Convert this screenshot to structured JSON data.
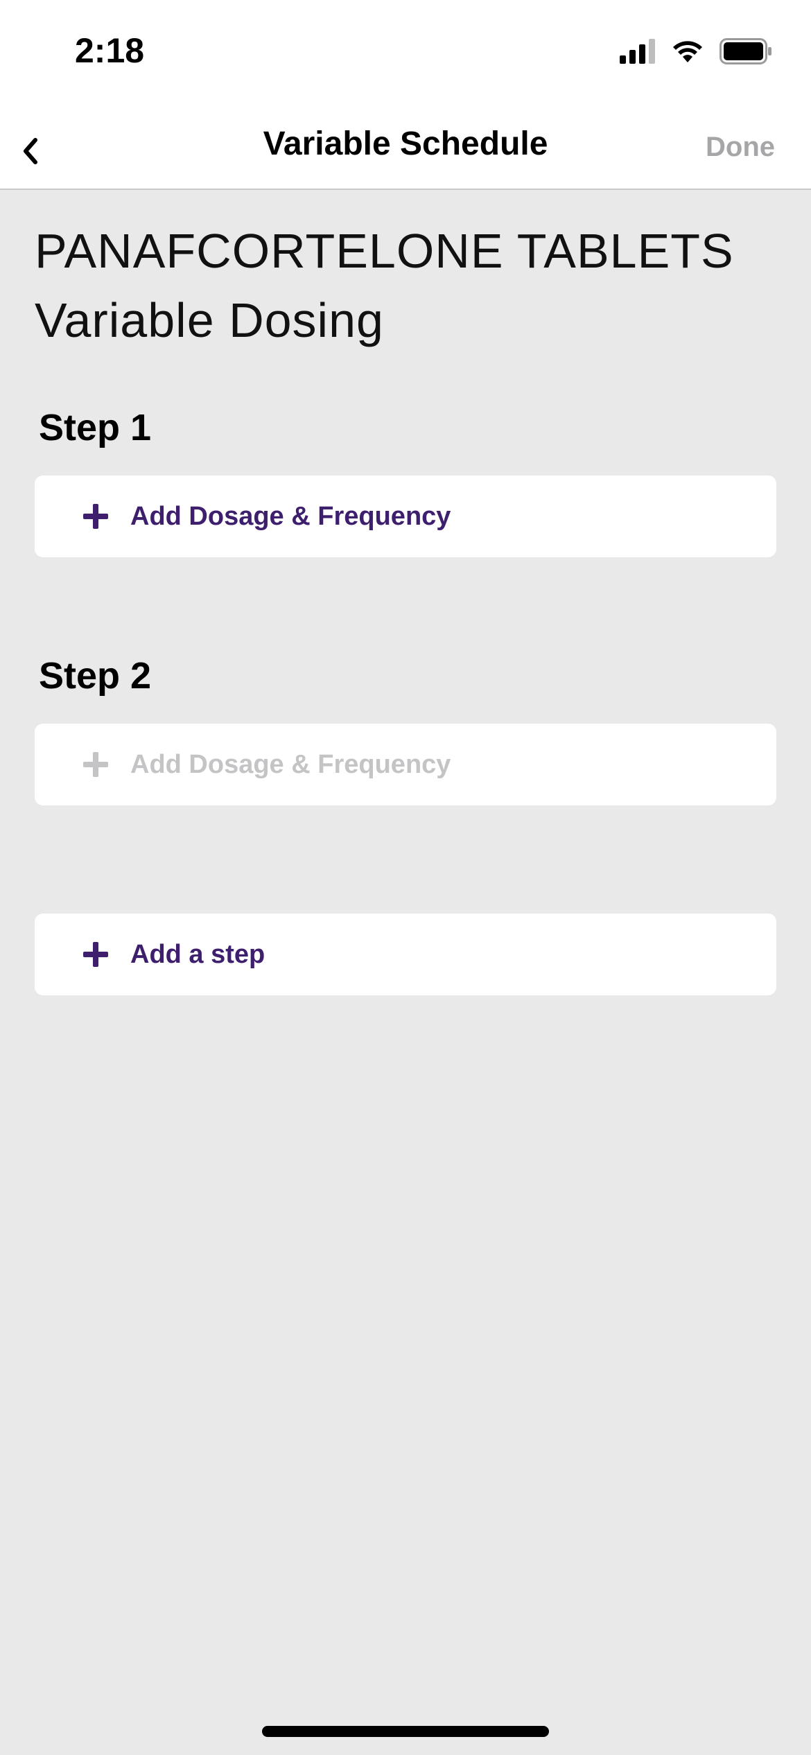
{
  "status_bar": {
    "time": "2:18"
  },
  "nav": {
    "title": "Variable Schedule",
    "done_label": "Done"
  },
  "medication": {
    "name": "PANAFCORTELONE TABLETS",
    "subtitle": "Variable Dosing"
  },
  "steps": [
    {
      "heading": "Step 1",
      "action_label": "Add Dosage & Frequency",
      "enabled": true
    },
    {
      "heading": "Step 2",
      "action_label": "Add Dosage & Frequency",
      "enabled": false
    }
  ],
  "add_step": {
    "label": "Add a step"
  },
  "colors": {
    "accent": "#3e1f6e",
    "disabled": "#c4c4c6",
    "background": "#e9e9ea"
  }
}
